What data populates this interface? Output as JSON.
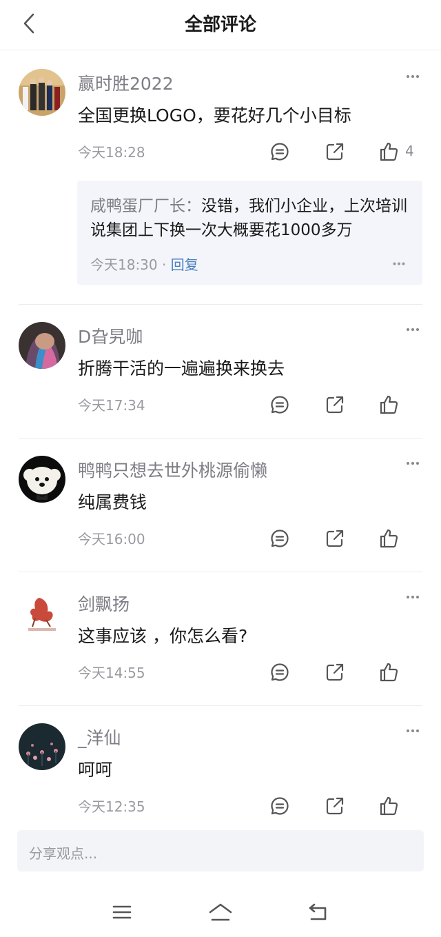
{
  "header": {
    "title": "全部评论"
  },
  "comments": [
    {
      "username": "赢时胜2022",
      "text": "全国更换LOGO，要花好几个小目标",
      "time": "今天18:28",
      "likes": "4"
    },
    {
      "username": "D旮旯咖",
      "text": "折腾干活的一遍遍换来换去",
      "time": "今天17:34",
      "likes": ""
    },
    {
      "username": "鸭鸭只想去世外桃源偷懒",
      "text": "纯属费钱",
      "time": "今天16:00",
      "likes": ""
    },
    {
      "username": "剑飘扬",
      "text": "这事应该 ，你怎么看?",
      "time": "今天14:55",
      "likes": ""
    },
    {
      "username": "_洋仙",
      "text": "呵呵",
      "time": "今天12:35",
      "likes": ""
    }
  ],
  "reply": {
    "author": "咸鸭蛋厂厂长：",
    "text": "没错，我们小企业，上次培训说集团上下换一次大概要花1000多万",
    "time": "今天18:30",
    "separator": " · ",
    "reply_label": "回复"
  },
  "footer": {
    "input_placeholder": "分享观点..."
  },
  "icons": {
    "back": "chevron-left-icon",
    "more": "more-dots-icon",
    "reply": "comment-bubble-icon",
    "share": "share-arrow-icon",
    "like": "thumbs-up-icon",
    "menu": "menu-icon",
    "home": "home-icon",
    "return": "return-icon"
  },
  "colors": {
    "link": "#4a7fbf",
    "muted": "#9a9aa0",
    "username": "#7d7d85",
    "reply_bg": "#f3f5fa"
  }
}
